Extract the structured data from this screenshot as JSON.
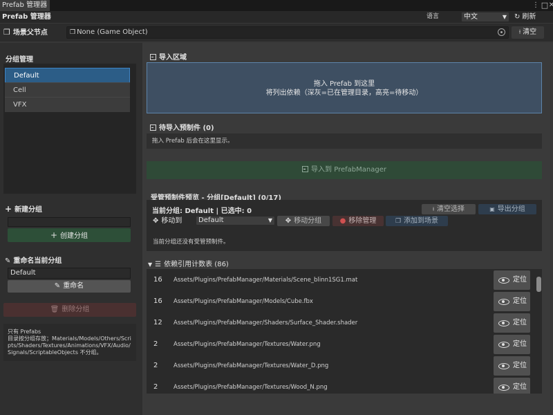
{
  "tab": {
    "title": "Prefab 管理器"
  },
  "header": {
    "title": "Prefab 管理器",
    "language_label": "语言",
    "language_value": "中文",
    "refresh_label": "刷新"
  },
  "parent": {
    "label": "场景父节点",
    "value": "None (Game Object)",
    "clear_label": "清空"
  },
  "groups": {
    "title": "分组管理",
    "items": [
      {
        "label": "Default",
        "selected": true
      },
      {
        "label": "Cell"
      },
      {
        "label": "VFX"
      }
    ]
  },
  "new_group": {
    "title": "新建分组",
    "value": "",
    "create_label": "创建分组"
  },
  "rename": {
    "title": "重命名当前分组",
    "value": "Default",
    "button_label": "重命名"
  },
  "delete_label": "删除分组",
  "info": {
    "line1": "只有 Prefabs",
    "line2": "目录按分组存放；Materials/Models/Others/Scripts/Shaders/Textures/Animations/VFX/Audio/Signals/ScriptableObjects 不分组。"
  },
  "import_area": {
    "title": "导入区域",
    "line1": "拖入 Prefab 到这里",
    "line2": "将列出依赖（深灰=已在管理目录，高亮=待移动）"
  },
  "pending": {
    "title": "待导入预制件 (0)",
    "hint": "拖入 Prefab 后会在这里显示。",
    "import_button": "导入到 PrefabManager"
  },
  "managed": {
    "title": "受管预制件预览 - 分组[Default] (0/17)",
    "status": "当前分组: Default | 已选中: 0",
    "clear_sel": "清空选择",
    "export_group": "导出分组",
    "move_to": "移动到",
    "move_target": "Default",
    "move_group": "移动分组",
    "remove": "移除管理",
    "add_scene": "添加到场景",
    "empty_hint": "当前分组还没有受管预制件。"
  },
  "deps": {
    "title": "依赖引用计数表 (86)",
    "locate_label": "定位",
    "rows": [
      {
        "count": "16",
        "path": "Assets/Plugins/PrefabManager/Materials/Scene_blinn1SG1.mat"
      },
      {
        "count": "16",
        "path": "Assets/Plugins/PrefabManager/Models/Cube.fbx"
      },
      {
        "count": "12",
        "path": "Assets/Plugins/PrefabManager/Shaders/Surface_Shader.shader"
      },
      {
        "count": "2",
        "path": "Assets/Plugins/PrefabManager/Textures/Water.png"
      },
      {
        "count": "2",
        "path": "Assets/Plugins/PrefabManager/Textures/Water_D.png"
      },
      {
        "count": "2",
        "path": "Assets/Plugins/PrefabManager/Textures/Wood_N.png"
      }
    ]
  }
}
